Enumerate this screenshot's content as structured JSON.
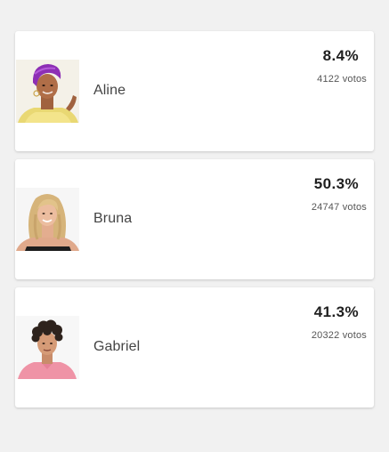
{
  "candidates": [
    {
      "name": "Aline",
      "percent": "8.4%",
      "votes": "4122 votos",
      "photo_icon": "contestant-portrait-aline"
    },
    {
      "name": "Bruna",
      "percent": "50.3%",
      "votes": "24747 votos",
      "photo_icon": "contestant-portrait-bruna"
    },
    {
      "name": "Gabriel",
      "percent": "41.3%",
      "votes": "20322 votos",
      "photo_icon": "contestant-portrait-gabriel"
    }
  ]
}
